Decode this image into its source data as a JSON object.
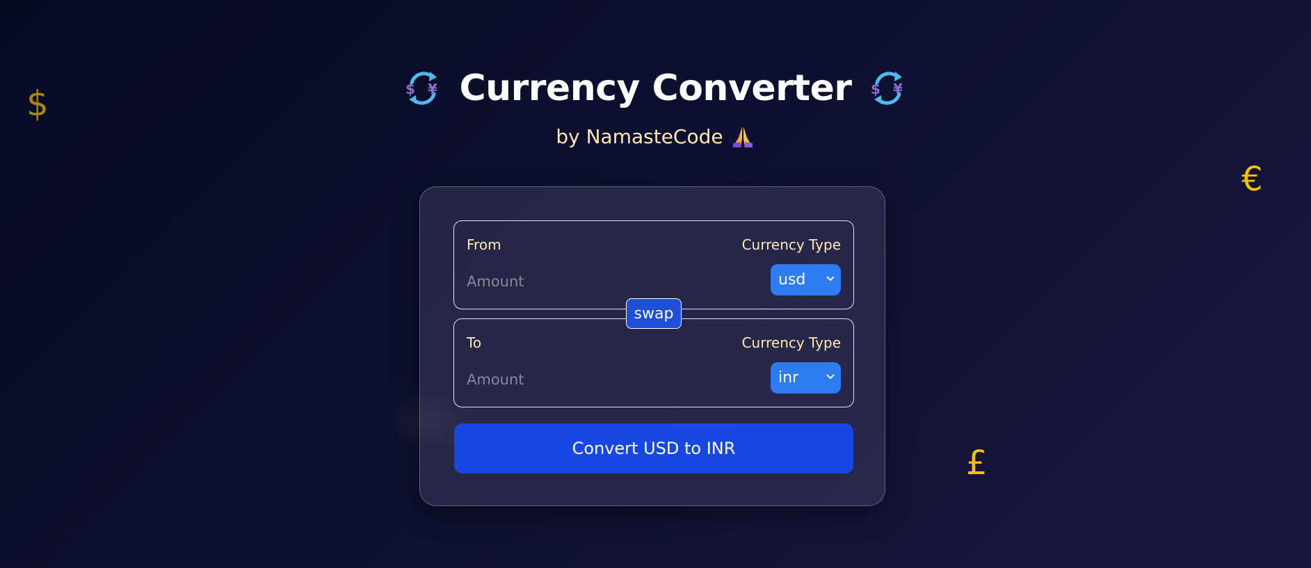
{
  "background_symbols": {
    "dollar": "$",
    "euro": "€",
    "pound": "£"
  },
  "header": {
    "title": "Currency Converter",
    "subtitle": "by NamasteCode",
    "title_icon": "currency-exchange-icon",
    "subtitle_icon": "folded-hands-icon"
  },
  "converter": {
    "from": {
      "label": "From",
      "currency_type_label": "Currency Type",
      "amount_placeholder": "Amount",
      "selected_currency": "usd"
    },
    "swap_label": "swap",
    "to": {
      "label": "To",
      "currency_type_label": "Currency Type",
      "amount_placeholder": "Amount",
      "selected_currency": "inr"
    },
    "convert_label": "Convert USD to INR"
  },
  "colors": {
    "accent": "#1748e3",
    "select": "#2f7bf2",
    "label": "#fde9b0",
    "symbol": "#f2c200"
  }
}
